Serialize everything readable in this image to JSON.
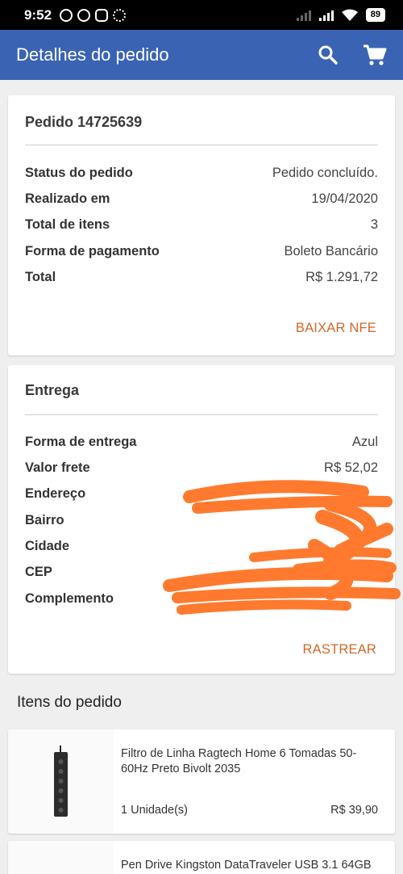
{
  "status_bar": {
    "time": "9:52",
    "battery": "89"
  },
  "app_bar": {
    "title": "Detalhes do pedido",
    "search_icon": "search-icon",
    "cart_icon": "cart-icon"
  },
  "order": {
    "title": "Pedido 14725639",
    "rows": [
      {
        "label": "Status do pedido",
        "value": "Pedido concluído."
      },
      {
        "label": "Realizado em",
        "value": "19/04/2020"
      },
      {
        "label": "Total de itens",
        "value": "3"
      },
      {
        "label": "Forma de pagamento",
        "value": "Boleto Bancário"
      },
      {
        "label": "Total",
        "value": "R$ 1.291,72"
      }
    ],
    "action": "BAIXAR NFE"
  },
  "delivery": {
    "title": "Entrega",
    "rows": [
      {
        "label": "Forma de entrega",
        "value": "Azul"
      },
      {
        "label": "Valor frete",
        "value": "R$ 52,02"
      },
      {
        "label": "Endereço",
        "value": ""
      },
      {
        "label": "Bairro",
        "value": ""
      },
      {
        "label": "Cidade",
        "value": ""
      },
      {
        "label": "CEP",
        "value": ""
      },
      {
        "label": "Complemento",
        "value": ""
      }
    ],
    "action": "RASTREAR"
  },
  "items_section": {
    "label": "Itens do pedido",
    "items": [
      {
        "name": "Filtro de Linha Ragtech Home 6 Tomadas 50-60Hz Preto Bivolt 2035",
        "qty": "1 Unidade(s)",
        "price": "R$ 39,90"
      },
      {
        "name": "Pen Drive Kingston DataTraveler USB 3.1 64GB",
        "qty": "",
        "price": ""
      }
    ]
  },
  "colors": {
    "app_bar": "#3a64b3",
    "accent": "#d0682a",
    "redaction": "#ff7a2e"
  }
}
